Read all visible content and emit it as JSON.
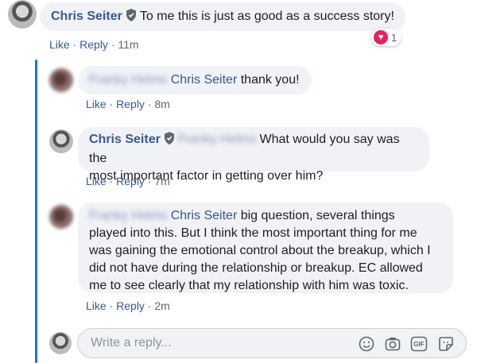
{
  "comment1": {
    "author": "Chris Seiter",
    "text": "To me this is just as good as a success story!",
    "actions": {
      "like": "Like",
      "reply": "Reply",
      "time": "11m"
    },
    "reactions": {
      "count": "1",
      "icon": "heart-icon"
    }
  },
  "reply1": {
    "author": "Franky Helms",
    "mention": "Chris Seiter",
    "text": "thank you!",
    "actions": {
      "like": "Like",
      "reply": "Reply",
      "time": "8m"
    }
  },
  "reply2": {
    "author": "Chris Seiter",
    "mention": "Franky Helms",
    "text_line1": "What would you say was the",
    "text_line2": "most important factor in getting over him?",
    "actions": {
      "like": "Like",
      "reply": "Reply",
      "time": "7m"
    }
  },
  "reply3": {
    "author": "Franky Helms",
    "mention": "Chris Seiter",
    "lines": [
      "big question, several things",
      "played into this. But I think the most important thing for me",
      "was gaining the emotional control about the breakup, which I",
      "did not have during the relationship or breakup. EC allowed",
      "me to see clearly that my relationship with him was toxic."
    ],
    "actions": {
      "like": "Like",
      "reply": "Reply",
      "time": "2m"
    }
  },
  "composer": {
    "placeholder": "Write a reply...",
    "tools": [
      "emoji-icon",
      "camera-icon",
      "gif-icon",
      "sticker-icon"
    ],
    "gif_label": "GIF"
  },
  "colors": {
    "link": "#385898",
    "bubble": "#f0f2f5",
    "thread": "#1d6ff2",
    "heart": "#e0245e"
  }
}
